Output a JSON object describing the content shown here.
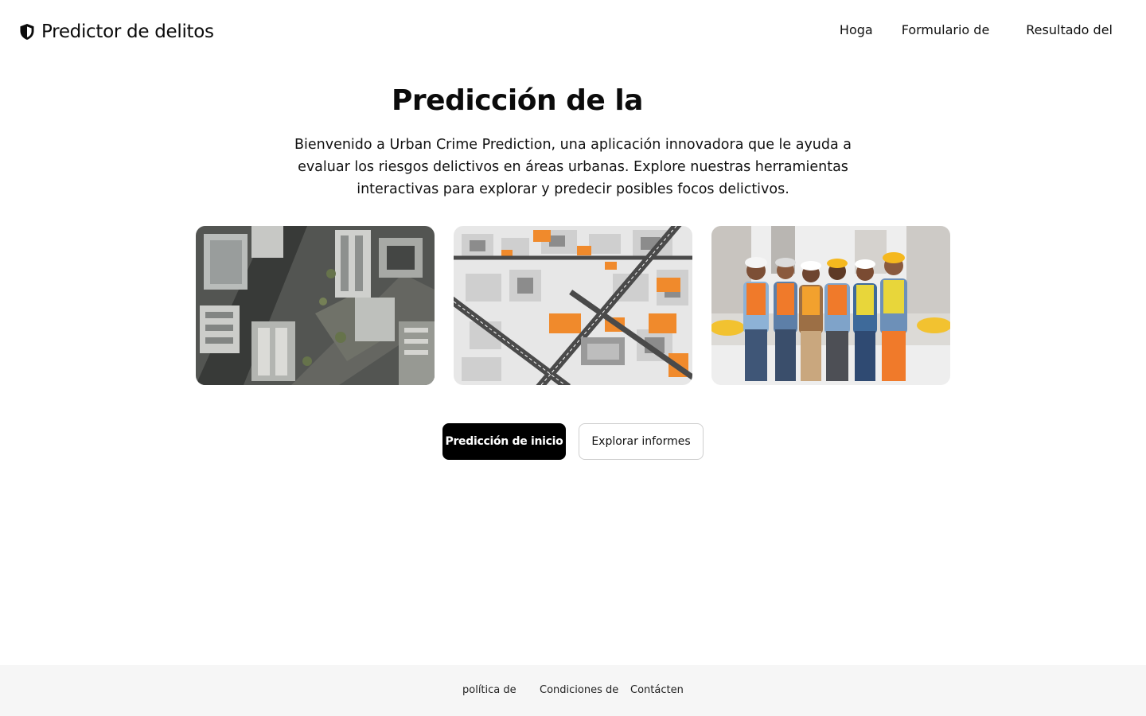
{
  "header": {
    "brand_name": "Predictor de delitos",
    "brand_icon": "shield-icon",
    "nav": [
      {
        "label": "Hoga"
      },
      {
        "label": "Formulario de"
      },
      {
        "label": "Resultado del"
      }
    ]
  },
  "hero": {
    "title": "Predicción de la",
    "description": "Bienvenido a Urban Crime Prediction, una aplicación innovadora que le ayuda a evaluar los riesgos delictivos en áreas urbanas. Explore nuestras herramientas interactivas para explorar y predecir posibles focos delictivos."
  },
  "gallery": [
    {
      "alt": "aerial-city-photo"
    },
    {
      "alt": "isometric-crime-map"
    },
    {
      "alt": "workers-group-illustration"
    }
  ],
  "actions": {
    "primary_label": "Predicción de inicio",
    "secondary_label": "Explorar informes"
  },
  "footer": {
    "links": [
      {
        "label": "política de"
      },
      {
        "label": "Condiciones de"
      },
      {
        "label": "Contácten"
      }
    ]
  },
  "colors": {
    "primary": "#000000",
    "accent_orange": "#f08a2c",
    "footer_bg": "#f6f6f6"
  }
}
